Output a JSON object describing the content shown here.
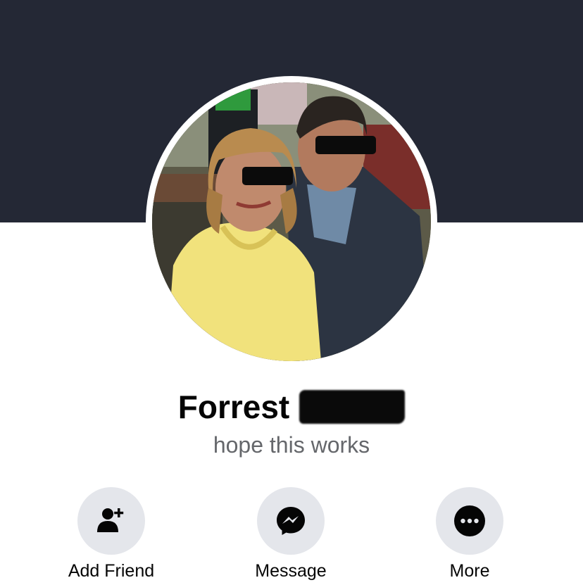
{
  "profile": {
    "first_name": "Forrest",
    "bio": "hope this works"
  },
  "actions": [
    {
      "label": "Add Friend",
      "icon": "add-friend-icon"
    },
    {
      "label": "Message",
      "icon": "messenger-icon"
    },
    {
      "label": "More",
      "icon": "more-icon"
    }
  ],
  "colors": {
    "cover": "#242835",
    "action_circle": "#e4e6eb",
    "text": "#050505",
    "secondary_text": "#65676b"
  }
}
